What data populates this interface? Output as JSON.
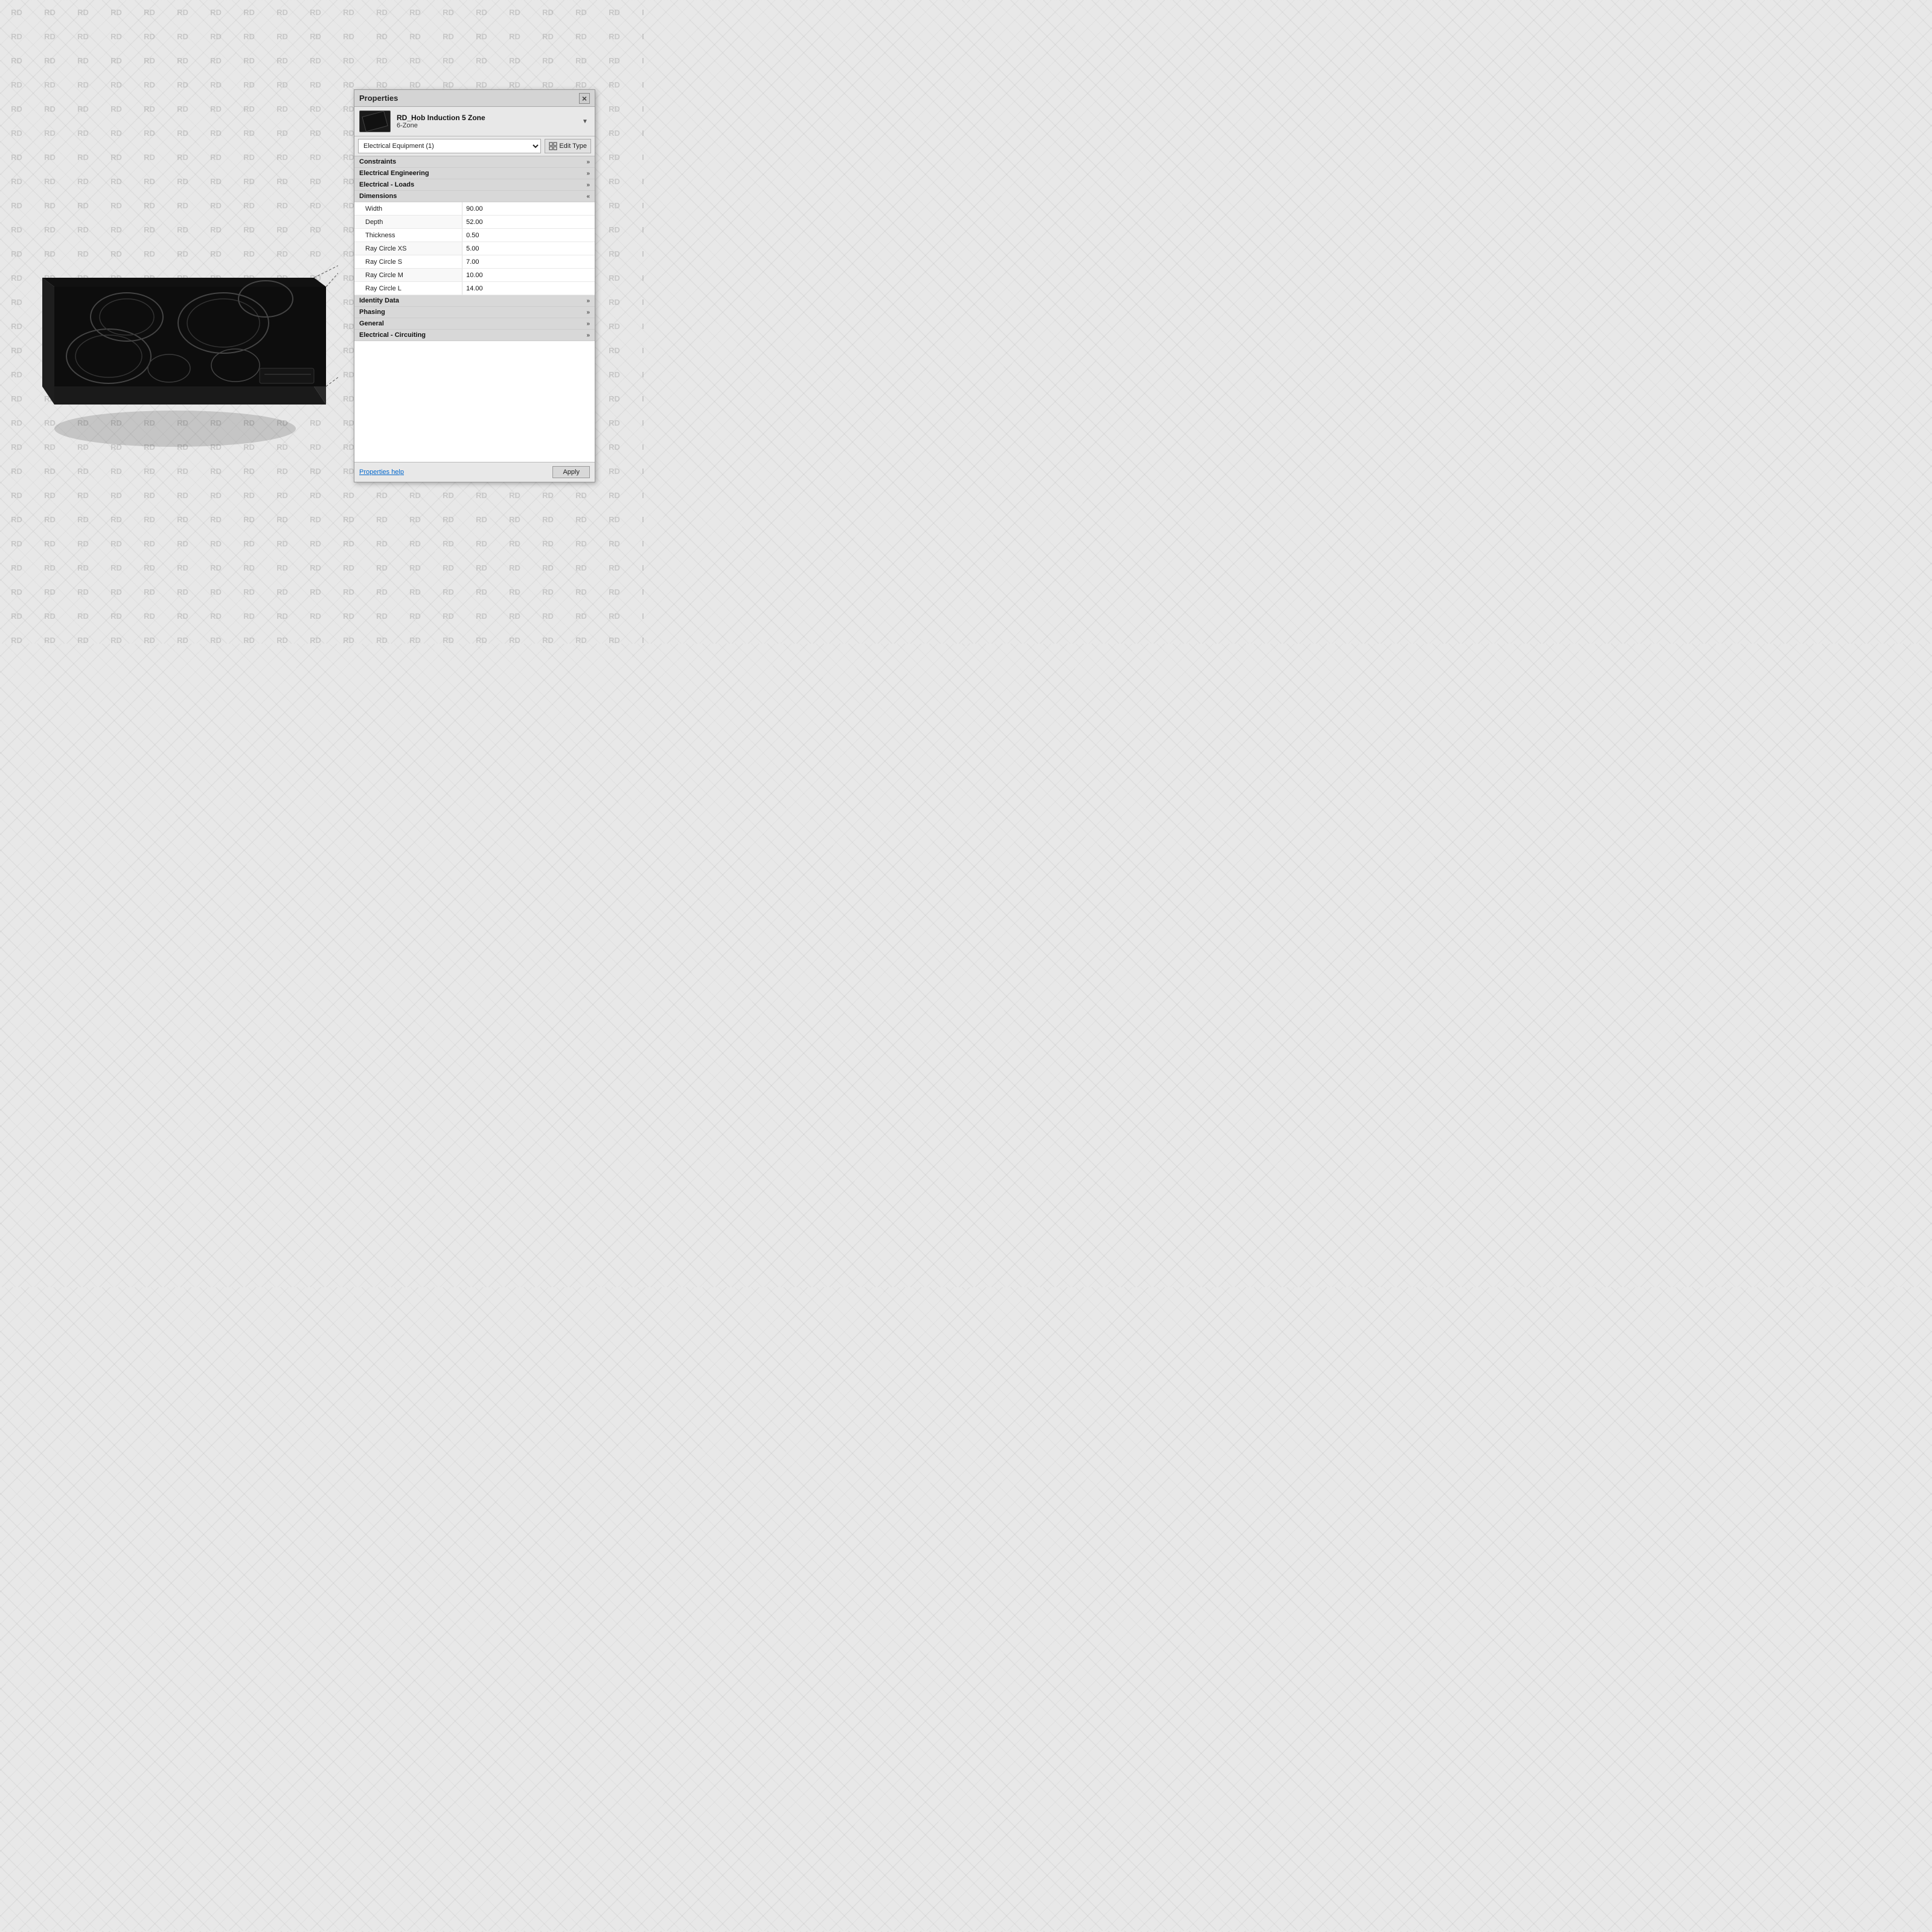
{
  "watermark": {
    "text": "RD",
    "cols": 20,
    "rows": 27
  },
  "panel": {
    "title": "Properties",
    "close_label": "×",
    "object": {
      "name": "RD_Hob Induction 5 Zone",
      "type": "6-Zone"
    },
    "dropdown": {
      "value": "Electrical Equipment (1)",
      "options": [
        "Electrical Equipment (1)"
      ]
    },
    "edit_type_label": "Edit Type",
    "sections": [
      {
        "id": "constraints",
        "label": "Constraints",
        "expanded": false,
        "properties": []
      },
      {
        "id": "electrical_engineering",
        "label": "Electrical Engineering",
        "expanded": false,
        "properties": []
      },
      {
        "id": "electrical_loads",
        "label": "Electrical - Loads",
        "expanded": false,
        "properties": []
      },
      {
        "id": "dimensions",
        "label": "Dimensions",
        "expanded": true,
        "properties": [
          {
            "label": "Width",
            "value": "90.00"
          },
          {
            "label": "Depth",
            "value": "52.00"
          },
          {
            "label": "Thickness",
            "value": "0.50"
          },
          {
            "label": "Ray Circle XS",
            "value": "5.00"
          },
          {
            "label": "Ray Circle S",
            "value": "7.00"
          },
          {
            "label": "Ray Circle M",
            "value": "10.00"
          },
          {
            "label": "Ray Circle L",
            "value": "14.00"
          }
        ]
      },
      {
        "id": "identity_data",
        "label": "Identity Data",
        "expanded": false,
        "properties": []
      },
      {
        "id": "phasing",
        "label": "Phasing",
        "expanded": false,
        "properties": []
      },
      {
        "id": "general",
        "label": "General",
        "expanded": false,
        "properties": []
      },
      {
        "id": "electrical_circuiting",
        "label": "Electrical - Circuiting",
        "expanded": false,
        "properties": []
      }
    ],
    "footer": {
      "help_link": "Properties help",
      "apply_button": "Apply"
    }
  }
}
